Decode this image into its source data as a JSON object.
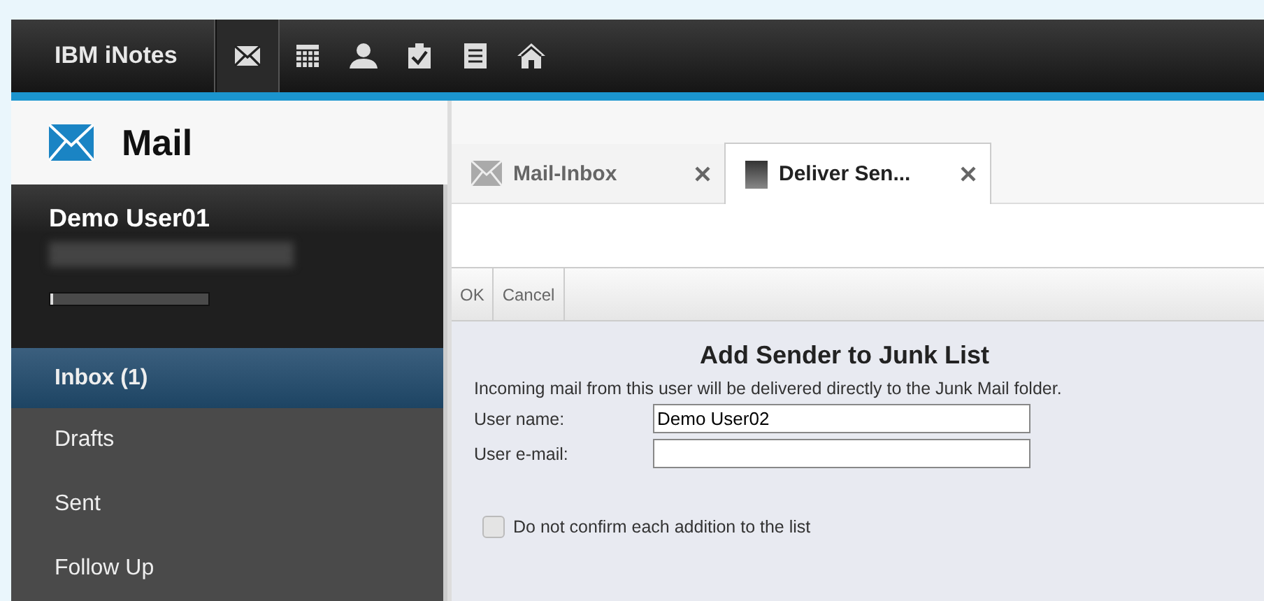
{
  "top_bar": {
    "brand": "IBM iNotes",
    "apps": [
      {
        "kind": "mail",
        "selected": true
      },
      {
        "kind": "calendar",
        "selected": false
      },
      {
        "kind": "contacts",
        "selected": false
      },
      {
        "kind": "todo",
        "selected": false
      },
      {
        "kind": "notebook",
        "selected": false
      },
      {
        "kind": "home",
        "selected": false
      }
    ]
  },
  "app_title": "Mail",
  "sidebar": {
    "user": "Demo User01",
    "quota": {
      "level": 0.02
    },
    "items": [
      {
        "label": "Inbox (1)",
        "selected": true
      },
      {
        "label": "Drafts",
        "selected": false
      },
      {
        "label": "Sent",
        "selected": false
      },
      {
        "label": "Follow Up",
        "selected": false
      }
    ]
  },
  "tabs": [
    {
      "label": "Mail-Inbox",
      "kind": "mail",
      "selected": false
    },
    {
      "label": "Deliver Sen...",
      "kind": "document",
      "selected": true
    }
  ],
  "toolbar": [
    "OK",
    "Cancel"
  ],
  "form": {
    "title": "Add Sender to Junk List",
    "description": "Incoming mail from this user will be delivered directly to the Junk Mail folder.",
    "fields": [
      {
        "label": "User name:",
        "value": "Demo User02"
      },
      {
        "label": "User e-mail:"
      }
    ],
    "option": {
      "label": "Do not confirm each addition to the list",
      "checked": false
    }
  }
}
